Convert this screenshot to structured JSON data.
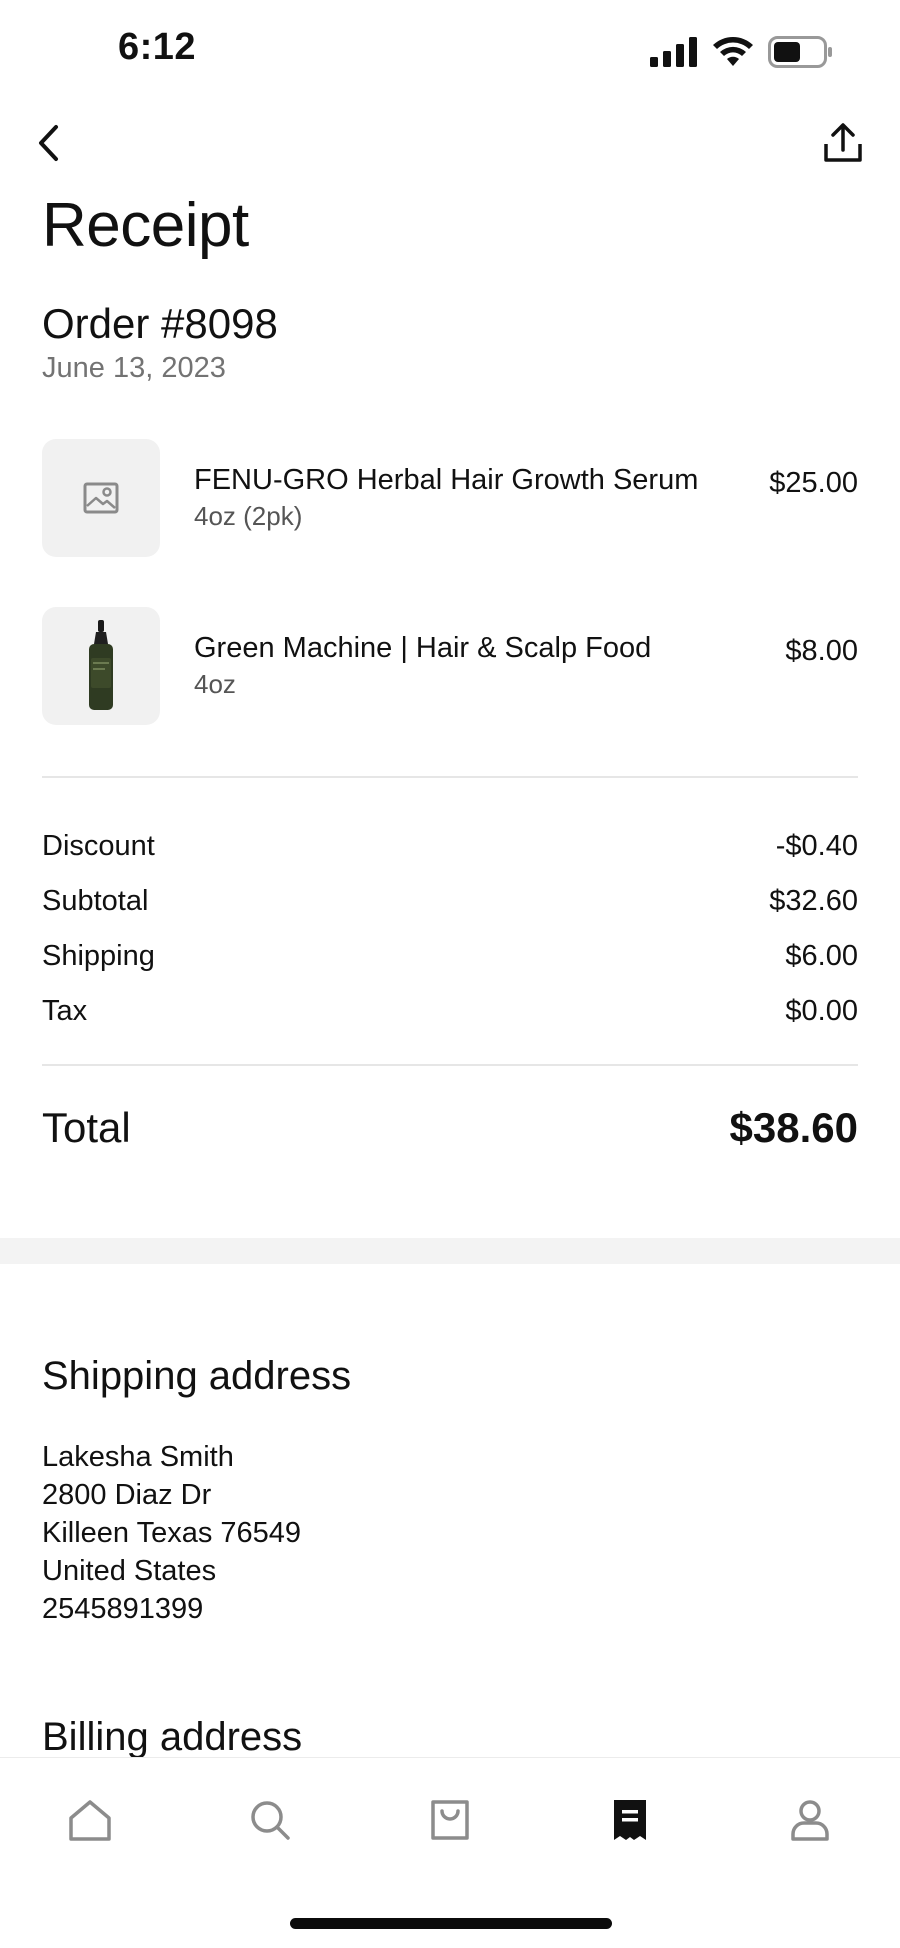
{
  "status_bar": {
    "time": "6:12"
  },
  "header": {
    "title": "Receipt"
  },
  "order": {
    "number": "Order #8098",
    "date": "June 13, 2023"
  },
  "items": [
    {
      "name": "FENU-GRO Herbal Hair Growth Serum",
      "variant": "4oz (2pk)",
      "price": "$25.00",
      "thumb_icon": "image-placeholder-icon"
    },
    {
      "name": "Green Machine | Hair & Scalp Food",
      "variant": "4oz",
      "price": "$8.00",
      "thumb_icon": "product-bottle-image"
    }
  ],
  "summary": {
    "discount_label": "Discount",
    "discount_value": "-$0.40",
    "subtotal_label": "Subtotal",
    "subtotal_value": "$32.60",
    "shipping_label": "Shipping",
    "shipping_value": "$6.00",
    "tax_label": "Tax",
    "tax_value": "$0.00",
    "total_label": "Total",
    "total_value": "$38.60"
  },
  "shipping_address": {
    "title": "Shipping address",
    "name": "Lakesha Smith",
    "street": "2800 Diaz Dr",
    "city_line": "Killeen Texas 76549",
    "country": "United States",
    "phone": "2545891399"
  },
  "billing_address": {
    "title": "Billing address"
  },
  "tabbar": {
    "tabs": [
      {
        "icon": "home-icon",
        "active": false
      },
      {
        "icon": "search-icon",
        "active": false
      },
      {
        "icon": "shopping-bag-icon",
        "active": false
      },
      {
        "icon": "receipt-icon",
        "active": true
      },
      {
        "icon": "profile-icon",
        "active": false
      }
    ]
  },
  "colors": {
    "text": "#111111",
    "muted": "#737373",
    "divider": "#e6e6e6",
    "thumb_bg": "#f1f1f1",
    "band": "#f3f3f3"
  }
}
